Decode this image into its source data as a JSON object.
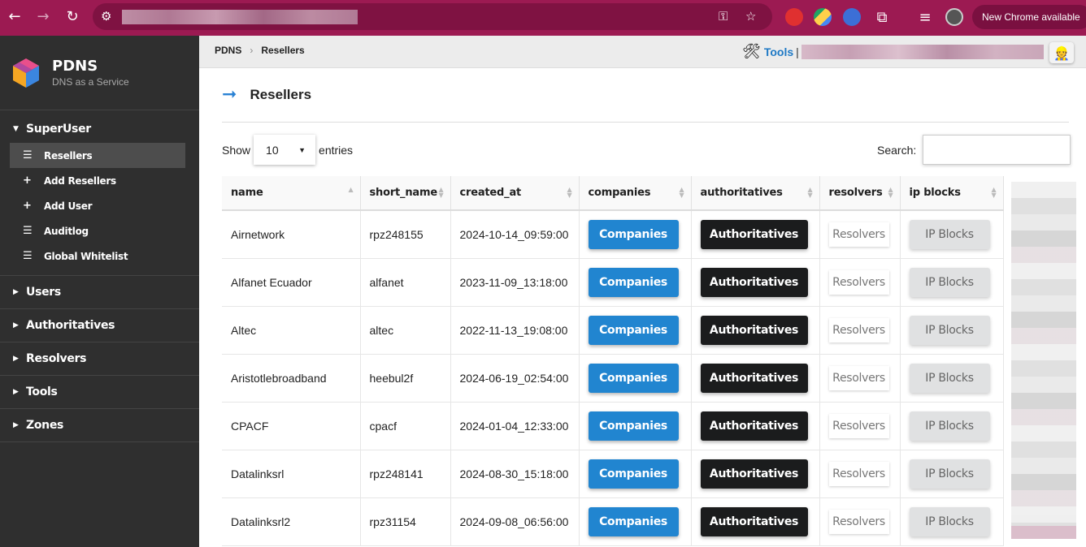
{
  "browser": {
    "new_chrome_label": "New Chrome available",
    "accent": "#9c1a52"
  },
  "sidebar": {
    "brand_name": "PDNS",
    "brand_tagline": "DNS as a Service",
    "superuser": {
      "label": "SuperUser",
      "items": [
        {
          "label": "Resellers",
          "icon": "list-icon",
          "active": true
        },
        {
          "label": "Add Resellers",
          "icon": "plus-icon"
        },
        {
          "label": "Add User",
          "icon": "plus-icon"
        },
        {
          "label": "Auditlog",
          "icon": "list-icon"
        },
        {
          "label": "Global Whitelist",
          "icon": "list-icon"
        }
      ]
    },
    "groups": [
      "Users",
      "Authoritatives",
      "Resolvers",
      "Tools",
      "Zones"
    ]
  },
  "topbar": {
    "breadcrumb_root": "PDNS",
    "breadcrumb_current": "Resellers",
    "tools_label": "Tools",
    "tools_separator": "|"
  },
  "page": {
    "title": "Resellers",
    "show_label": "Show",
    "entries_value": "10",
    "entries_label": "entries",
    "search_label": "Search:",
    "search_value": ""
  },
  "table": {
    "headers": [
      "name",
      "short_name",
      "created_at",
      "companies",
      "authoritatives",
      "resolvers",
      "ip blocks"
    ],
    "button_labels": {
      "companies": "Companies",
      "authoritatives": "Authoritatives",
      "resolvers": "Resolvers",
      "ip_blocks": "IP Blocks"
    },
    "rows": [
      {
        "name": "Airnetwork",
        "short_name": "rpz248155",
        "created_at": "2024-10-14_09:59:00"
      },
      {
        "name": "Alfanet Ecuador",
        "short_name": "alfanet",
        "created_at": "2023-11-09_13:18:00"
      },
      {
        "name": "Altec",
        "short_name": "altec",
        "created_at": "2022-11-13_19:08:00"
      },
      {
        "name": "Aristotlebroadband",
        "short_name": "heebul2f",
        "created_at": "2024-06-19_02:54:00"
      },
      {
        "name": "CPACF",
        "short_name": "cpacf",
        "created_at": "2024-01-04_12:33:00"
      },
      {
        "name": "Datalinksrl",
        "short_name": "rpz248141",
        "created_at": "2024-08-30_15:18:00"
      },
      {
        "name": "Datalinksrl2",
        "short_name": "rpz31154",
        "created_at": "2024-09-08_06:56:00"
      }
    ]
  }
}
